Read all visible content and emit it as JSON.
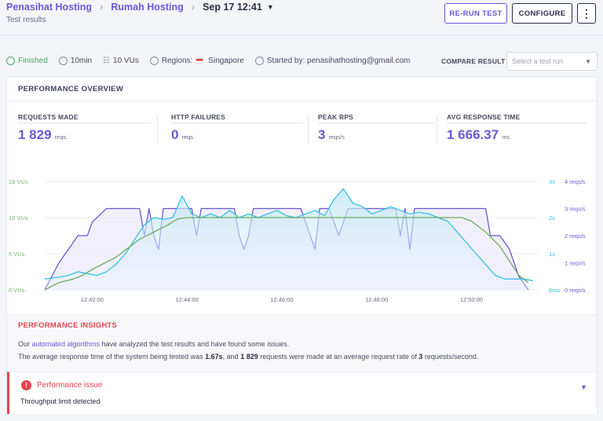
{
  "header": {
    "breadcrumbs": [
      "Penasihat Hosting",
      "Rumah Hosting"
    ],
    "run_date": "Sep 17 12:41",
    "subtitle": "Test results",
    "rerun_label": "RE-RUN TEST",
    "configure_label": "CONFIGURE",
    "more_label": "⋮"
  },
  "status": {
    "state": "Finished",
    "duration": "10min",
    "vus": "10 VUs",
    "regions_label": "Regions:",
    "region": "Singapore",
    "started_by": "Started by: penasihathosting@gmail.com"
  },
  "compare": {
    "label": "COMPARE RESULT",
    "placeholder": "Select a test run"
  },
  "overview": {
    "title": "PERFORMANCE OVERVIEW",
    "metrics": [
      {
        "label": "REQUESTS MADE",
        "value": "1 829",
        "unit": "reqs"
      },
      {
        "label": "HTTP FAILURES",
        "value": "0",
        "unit": "reqs"
      },
      {
        "label": "PEAK RPS",
        "value": "3",
        "unit": "reqs/s"
      },
      {
        "label": "AVG RESPONSE TIME",
        "value": "1 666.37",
        "unit": "ms"
      }
    ]
  },
  "chart_data": {
    "type": "line",
    "x_ticks": [
      "12:42:00",
      "12:44:00",
      "12:46:00",
      "12:48:00",
      "12:50:00"
    ],
    "y_left": {
      "ticks": [
        "0 VUs",
        "5 VUs",
        "10 VUs",
        "15 VUs"
      ],
      "range": [
        0,
        15
      ]
    },
    "y_resp": {
      "ticks": [
        "0ms",
        "1s",
        "2s",
        "3s"
      ],
      "range": [
        0,
        3
      ]
    },
    "y_rps": {
      "ticks": [
        "0 reqs/s",
        "1 reqs/s",
        "2 reqs/s",
        "3 reqs/s",
        "4 reqs/s"
      ],
      "range": [
        0,
        4
      ]
    },
    "x_range_min": [
      0,
      10.4
    ],
    "series": [
      {
        "color": "#6bab5a",
        "axis": "vus",
        "x": [
          0,
          0.3,
          0.6,
          0.8,
          1.0,
          1.2,
          1.5,
          1.8,
          2.0,
          2.3,
          2.6,
          2.8,
          3.0,
          3.2,
          5.0,
          7.0,
          8.8,
          9.0,
          9.3,
          9.6,
          9.8,
          10.0,
          10.2
        ],
        "y": [
          0,
          1,
          1.5,
          2,
          2.8,
          3.5,
          4.5,
          6,
          7,
          8,
          9,
          9.8,
          10,
          10,
          10,
          10,
          10,
          9.5,
          8,
          6,
          4,
          2,
          1
        ]
      },
      {
        "color": "#6c57d8",
        "axis": "rps",
        "x": [
          0,
          0.3,
          0.5,
          0.7,
          0.9,
          1.0,
          1.3,
          1.5,
          1.8,
          2.0,
          2.1,
          2.2,
          2.3,
          2.4,
          2.5,
          2.7,
          2.9,
          3.1,
          3.2,
          3.3,
          3.4,
          3.6,
          3.8,
          4.0,
          4.1,
          4.2,
          4.3,
          4.4,
          5.0,
          5.4,
          5.6,
          5.7,
          5.8,
          6.0,
          6.2,
          6.4,
          7.4,
          7.5,
          7.6,
          7.7,
          7.8,
          8.0,
          8.2,
          8.4,
          8.5,
          8.6,
          8.8,
          9.0,
          9.3,
          9.4,
          9.6,
          9.8,
          9.9,
          10.0,
          10.2
        ],
        "y": [
          0,
          1,
          1.5,
          2,
          2,
          2.5,
          3,
          3,
          3,
          3,
          2,
          3,
          2,
          1.5,
          3,
          3,
          3,
          3,
          2,
          3,
          3,
          3,
          3,
          3,
          2,
          1.5,
          2,
          3,
          3,
          3,
          2,
          1.5,
          3,
          3,
          2,
          3,
          3,
          2,
          3,
          1.5,
          3,
          3,
          3,
          3,
          3,
          3,
          3,
          3,
          3,
          2,
          2,
          1.5,
          1,
          0.5,
          0
        ]
      },
      {
        "color": "#34c1ea",
        "axis": "resp",
        "x": [
          0,
          0.3,
          0.5,
          0.7,
          0.9,
          1.1,
          1.3,
          1.5,
          1.7,
          1.9,
          2.1,
          2.3,
          2.5,
          2.7,
          2.9,
          3.1,
          3.3,
          3.5,
          3.7,
          3.9,
          4.1,
          4.3,
          4.5,
          4.7,
          4.9,
          5.1,
          5.3,
          5.5,
          5.7,
          5.9,
          6.1,
          6.3,
          6.5,
          6.7,
          6.9,
          7.1,
          7.3,
          7.5,
          7.7,
          7.9,
          8.1,
          8.3,
          8.5,
          8.7,
          8.9,
          9.1,
          9.3,
          9.5,
          9.7,
          9.9,
          10.1,
          10.3
        ],
        "y": [
          0.3,
          0.35,
          0.4,
          0.5,
          0.45,
          0.4,
          0.5,
          0.7,
          1.0,
          1.4,
          1.8,
          2.0,
          1.95,
          2.0,
          2.6,
          2.1,
          2.0,
          2.1,
          2.0,
          2.2,
          2.0,
          2.1,
          2.0,
          2.1,
          2.2,
          2.05,
          2.0,
          2.1,
          2.2,
          2.05,
          2.5,
          2.8,
          2.4,
          2.3,
          2.1,
          2.2,
          2.3,
          2.2,
          2.1,
          2.15,
          2.1,
          2.0,
          1.9,
          1.6,
          1.3,
          1.0,
          0.7,
          0.4,
          0.3,
          0.3,
          0.3,
          0.25
        ]
      }
    ]
  },
  "insights": {
    "title": "PERFORMANCE INSIGHTS",
    "line1_pre": "Our ",
    "line1_link": "automated algorithms",
    "line1_post": " have analyzed the test results and have found some issues.",
    "line2_a": "The average response time of the system being tested was ",
    "line2_b": "1.67s",
    "line2_c": ", and ",
    "line2_d": "1 829",
    "line2_e": " requests were made at an average request rate of ",
    "line2_f": "3",
    "line2_g": " requests/second.",
    "issue_title": "Performance issue",
    "issue_summary": "Throughput limit detected"
  }
}
